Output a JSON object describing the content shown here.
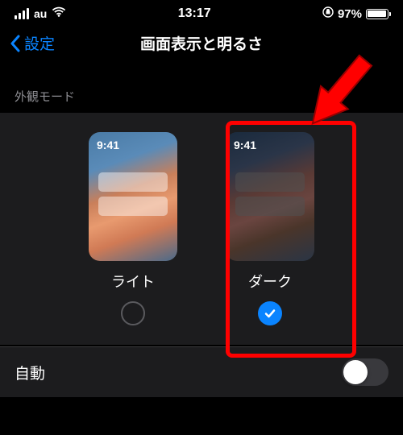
{
  "status": {
    "carrier": "au",
    "time": "13:17",
    "battery_pct": "97%",
    "battery_level": 97
  },
  "nav": {
    "back_label": "設定",
    "title": "画面表示と明るさ"
  },
  "appearance": {
    "section_label": "外観モード",
    "preview_time": "9:41",
    "light_label": "ライト",
    "dark_label": "ダーク",
    "selected": "dark"
  },
  "auto": {
    "label": "自動",
    "enabled": false
  }
}
